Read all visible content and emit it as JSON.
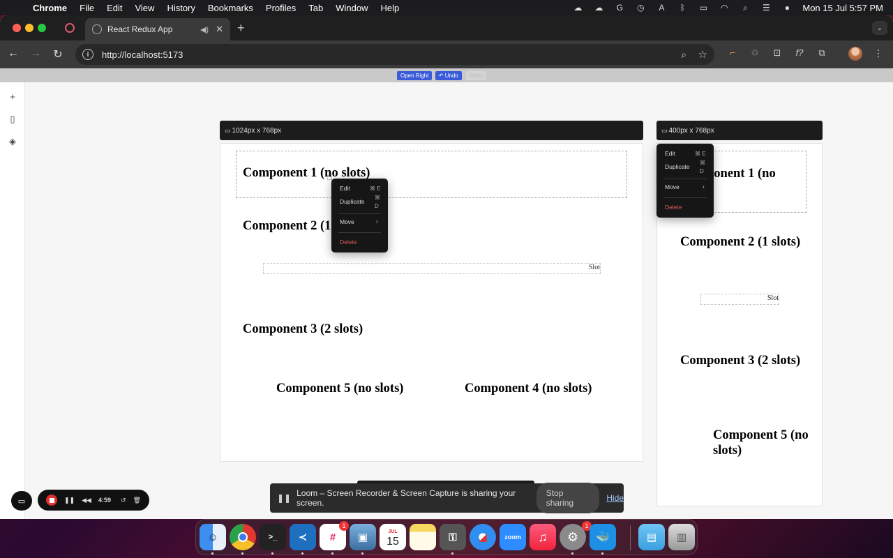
{
  "menubar": {
    "items": [
      "Chrome",
      "File",
      "Edit",
      "View",
      "History",
      "Bookmarks",
      "Profiles",
      "Tab",
      "Window",
      "Help"
    ],
    "clock": "Mon 15 Jul  5:57 PM"
  },
  "browser": {
    "tab_title": "React Redux App",
    "url": "http://localhost:5173"
  },
  "toolbar": {
    "open_right": "Open Right",
    "undo": "Undo",
    "redo": "Redo"
  },
  "frames": {
    "desktop": {
      "size_label": "1024px x 768px",
      "components": {
        "c1": "Component 1 (no slots)",
        "c2": "Component 2 (1 slots)",
        "c3": "Component 3 (2 slots)",
        "c4": "Component 4 (no slots)",
        "c5": "Component 5 (no slots)"
      },
      "slot_label": "Slot"
    },
    "mobile": {
      "size_label": "400px x 768px",
      "components": {
        "c1": "Component 1 (no slots)",
        "c2": "Component 2 (1 slots)",
        "c3": "Component 3 (2 slots)",
        "c5": "Component 5 (no slots)"
      },
      "slot_label": "Slot"
    }
  },
  "context_menu": {
    "edit": "Edit",
    "edit_shortcut": "⌘ E",
    "duplicate": "Duplicate",
    "duplicate_shortcut_1": "⌘",
    "duplicate_shortcut_2": "D",
    "move": "Move",
    "delete": "Delete"
  },
  "loom": {
    "timer": "4:59",
    "sharing_message": "Loom – Screen Recorder & Screen Capture is sharing your screen.",
    "stop_sharing": "Stop sharing",
    "hide": "Hide"
  },
  "dock": {
    "calendar_month": "JUL",
    "calendar_day": "15",
    "zoom_label": "zoom",
    "badge_slack": "1",
    "badge_settings": "1"
  },
  "colors": {
    "accent": "#3a5bd9",
    "delete": "#e05a5a",
    "frame_header": "#1c1c1c"
  }
}
